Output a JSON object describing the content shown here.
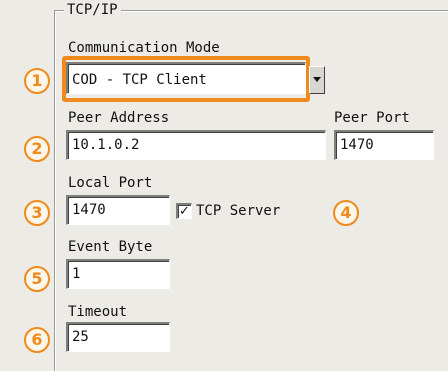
{
  "group": {
    "title": "TCP/IP"
  },
  "communication_mode": {
    "label": "Communication Mode",
    "value": "COD - TCP Client"
  },
  "peer_address": {
    "label": "Peer Address",
    "value": "10.1.0.2"
  },
  "peer_port": {
    "label": "Peer Port",
    "value": "1470"
  },
  "local_port": {
    "label": "Local Port",
    "value": "1470"
  },
  "tcp_server": {
    "label": "TCP Server",
    "checked": true,
    "check_glyph": "✓"
  },
  "event_byte": {
    "label": "Event Byte",
    "value": "1"
  },
  "timeout": {
    "label": "Timeout",
    "value": "25"
  },
  "badges": [
    "1",
    "2",
    "3",
    "4",
    "5",
    "6"
  ],
  "colors": {
    "accent": "#f08a1c",
    "background": "#ecebe6"
  }
}
